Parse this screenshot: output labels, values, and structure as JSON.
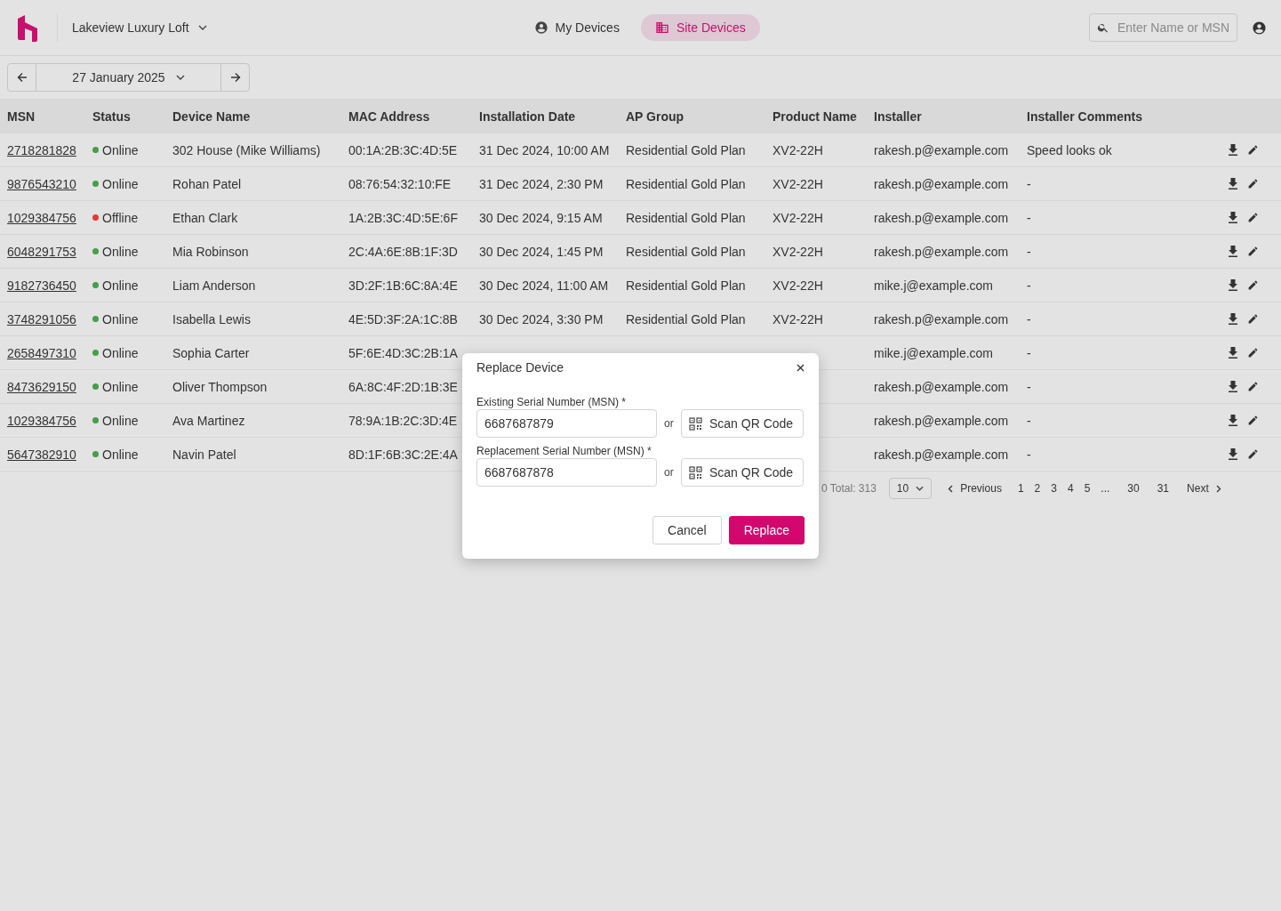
{
  "header": {
    "site": "Lakeview Luxury Loft",
    "nav": [
      {
        "label": "My Devices",
        "kind": "person",
        "selected": false
      },
      {
        "label": "Site Devices",
        "kind": "building",
        "selected": true
      }
    ],
    "search": {
      "placeholder": "Enter Name or MSN"
    }
  },
  "date_nav": {
    "date": "27 January 2025"
  },
  "table": {
    "columns": [
      "MSN",
      "Status",
      "Device Name",
      "MAC Address",
      "Installation Date",
      "AP Group",
      "Product Name",
      "Installer",
      "Installer Comments"
    ],
    "rows": [
      {
        "msn": "2718281828",
        "status": "Online",
        "color": "#43a047",
        "device_name": "302 House (Mike Williams)",
        "mac": "00:1A:2B:3C:4D:5E",
        "installation_date": "31 Dec 2024, 10:00 AM",
        "ap_group": "Residential Gold Plan",
        "product": "XV2-22H",
        "installer": "rakesh.p@example.com",
        "comments": "Speed looks ok"
      },
      {
        "msn": "9876543210",
        "status": "Online",
        "color": "#43a047",
        "device_name": "Rohan Patel",
        "mac": "08:76:54:32:10:FE",
        "installation_date": "31 Dec 2024, 2:30 PM",
        "ap_group": "Residential Gold Plan",
        "product": "XV2-22H",
        "installer": "rakesh.p@example.com",
        "comments": "-"
      },
      {
        "msn": "1029384756",
        "status": "Offline",
        "color": "#e53935",
        "device_name": "Ethan Clark",
        "mac": "1A:2B:3C:4D:5E:6F",
        "installation_date": "30 Dec 2024, 9:15 AM",
        "ap_group": "Residential Gold Plan",
        "product": "XV2-22H",
        "installer": "rakesh.p@example.com",
        "comments": "-"
      },
      {
        "msn": "6048291753",
        "status": "Online",
        "color": "#43a047",
        "device_name": "Mia Robinson",
        "mac": "2C:4A:6E:8B:1F:3D",
        "installation_date": "30 Dec 2024, 1:45 PM",
        "ap_group": "Residential Gold Plan",
        "product": "XV2-22H",
        "installer": "rakesh.p@example.com",
        "comments": "-"
      },
      {
        "msn": "9182736450",
        "status": "Online",
        "color": "#43a047",
        "device_name": "Liam Anderson",
        "mac": "3D:2F:1B:6C:8A:4E",
        "installation_date": "30 Dec 2024, 11:00 AM",
        "ap_group": "Residential Gold Plan",
        "product": "XV2-22H",
        "installer": "mike.j@example.com",
        "comments": "-"
      },
      {
        "msn": "3748291056",
        "status": "Online",
        "color": "#43a047",
        "device_name": "Isabella Lewis",
        "mac": "4E:5D:3F:2A:1C:8B",
        "installation_date": "30 Dec 2024, 3:30 PM",
        "ap_group": "Residential Gold Plan",
        "product": "XV2-22H",
        "installer": "rakesh.p@example.com",
        "comments": "-"
      },
      {
        "msn": "2658497310",
        "status": "Online",
        "color": "#43a047",
        "device_name": "Sophia Carter",
        "mac": "5F:6E:4D:3C:2B:1A",
        "installer": "mike.j@example.com",
        "comments": "-"
      },
      {
        "msn": "8473629150",
        "status": "Online",
        "color": "#43a047",
        "device_name": "Oliver Thompson",
        "mac": "6A:8C:4F:2D:1B:3E",
        "installer": "rakesh.p@example.com",
        "comments": "-"
      },
      {
        "msn": "1029384756",
        "status": "Online",
        "color": "#43a047",
        "device_name": "Ava Martinez",
        "mac": "78:9A:1B:2C:3D:4E",
        "installer": "rakesh.p@example.com",
        "comments": "-"
      },
      {
        "msn": "5647382910",
        "status": "Online",
        "color": "#43a047",
        "device_name": "Navin Patel",
        "mac": "8D:1F:6B:3C:2E:4A",
        "installer": "rakesh.p@example.com",
        "comments": "-"
      }
    ]
  },
  "pagination": {
    "summary": "0 Total: 313",
    "page_size": "10",
    "previous": "Previous",
    "pages": [
      "1",
      "2",
      "3",
      "4",
      "5",
      "...",
      "30",
      "31"
    ],
    "next": "Next"
  },
  "dialog": {
    "title": "Replace Device",
    "fields": [
      {
        "label": "Existing Serial Number (MSN) *",
        "value": "6687687879",
        "or": "or",
        "scan": "Scan QR Code"
      },
      {
        "label": "Replacement Serial Number (MSN) *",
        "value": "6687687878",
        "or": "or",
        "scan": "Scan QR Code"
      }
    ],
    "buttons": [
      {
        "label": "Cancel",
        "kind": "secondary"
      },
      {
        "label": "Replace",
        "kind": "primary"
      }
    ]
  }
}
